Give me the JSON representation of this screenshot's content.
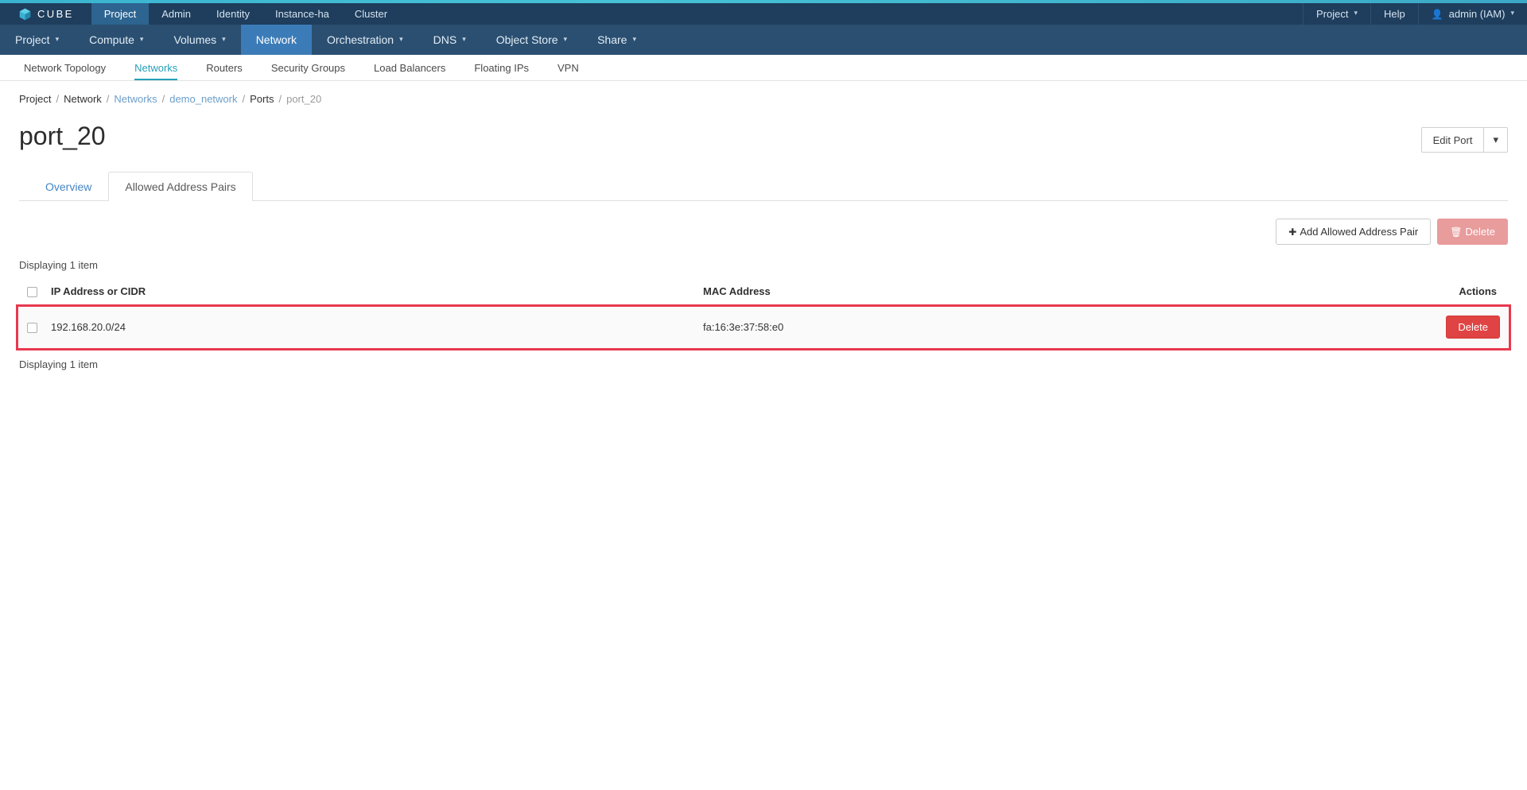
{
  "brand": {
    "name": "CUBE",
    "logo_icon": "cube-icon",
    "accent_color": "#3ab3d0"
  },
  "topbar": {
    "items": [
      {
        "label": "Project",
        "active": true
      },
      {
        "label": "Admin",
        "active": false
      },
      {
        "label": "Identity",
        "active": false
      },
      {
        "label": "Instance-ha",
        "active": false
      },
      {
        "label": "Cluster",
        "active": false
      }
    ],
    "right": {
      "project_selector": "Project",
      "help": "Help",
      "user": "admin (IAM)",
      "user_icon": "user-icon",
      "caret_icon": "chevron-down-icon"
    }
  },
  "mainnav": {
    "items": [
      {
        "label": "Project",
        "has_caret": true,
        "active": false
      },
      {
        "label": "Compute",
        "has_caret": true,
        "active": false
      },
      {
        "label": "Volumes",
        "has_caret": true,
        "active": false
      },
      {
        "label": "Network",
        "has_caret": false,
        "active": true
      },
      {
        "label": "Orchestration",
        "has_caret": true,
        "active": false
      },
      {
        "label": "DNS",
        "has_caret": true,
        "active": false
      },
      {
        "label": "Object Store",
        "has_caret": true,
        "active": false
      },
      {
        "label": "Share",
        "has_caret": true,
        "active": false
      }
    ]
  },
  "subnav": {
    "items": [
      {
        "label": "Network Topology",
        "active": false
      },
      {
        "label": "Networks",
        "active": true
      },
      {
        "label": "Routers",
        "active": false
      },
      {
        "label": "Security Groups",
        "active": false
      },
      {
        "label": "Load Balancers",
        "active": false
      },
      {
        "label": "Floating IPs",
        "active": false
      },
      {
        "label": "VPN",
        "active": false
      }
    ],
    "active_color": "#26a0b8"
  },
  "breadcrumb": [
    {
      "label": "Project",
      "link": false
    },
    {
      "label": "Network",
      "link": false
    },
    {
      "label": "Networks",
      "link": true
    },
    {
      "label": "demo_network",
      "link": true
    },
    {
      "label": "Ports",
      "link": false
    },
    {
      "label": "port_20",
      "link": false,
      "current": true
    }
  ],
  "page": {
    "title": "port_20",
    "edit_button": "Edit Port",
    "edit_button_caret": "chevron-down-icon"
  },
  "tabs": [
    {
      "label": "Overview",
      "active": false
    },
    {
      "label": "Allowed Address Pairs",
      "active": true
    }
  ],
  "toolbar": {
    "add_label": "Add Allowed Address Pair",
    "add_icon": "plus-icon",
    "delete_label": "Delete",
    "delete_icon": "trash-icon",
    "delete_disabled": true
  },
  "table": {
    "count_top": "Displaying 1 item",
    "count_bottom": "Displaying 1 item",
    "columns": [
      "IP Address or CIDR",
      "MAC Address",
      "Actions"
    ],
    "rows": [
      {
        "ip": "192.168.20.0/24",
        "mac": "fa:16:3e:37:58:e0",
        "action_label": "Delete",
        "highlighted": true
      }
    ]
  },
  "annotation": {
    "highlight_color": "#e8384f"
  }
}
